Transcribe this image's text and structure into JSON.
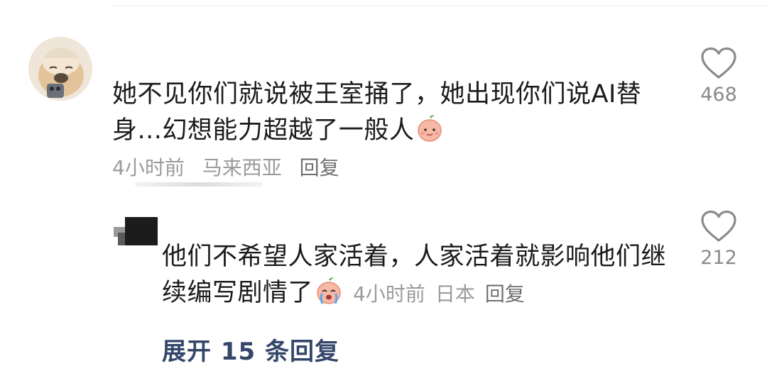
{
  "comments": [
    {
      "text": "她不见你们就说被王室捅了，她出现你们说AI替身...幻想能力超越了一般人",
      "emoji": "peach-face-emoji",
      "time": "4小时前",
      "location": "马来西亚",
      "reply_label": "回复",
      "likes": "468"
    },
    {
      "text": "他们不希望人家活着，人家活着就影响他们继续编写剧情了",
      "emoji": "crying-peach-emoji",
      "time": "4小时前",
      "location": "日本",
      "reply_label": "回复",
      "likes": "212"
    }
  ],
  "expand_replies": "展开 15 条回复",
  "colors": {
    "expand_link": "#34466a",
    "meta_text": "#9b9b9b",
    "like_icon": "#8a8a8a"
  }
}
